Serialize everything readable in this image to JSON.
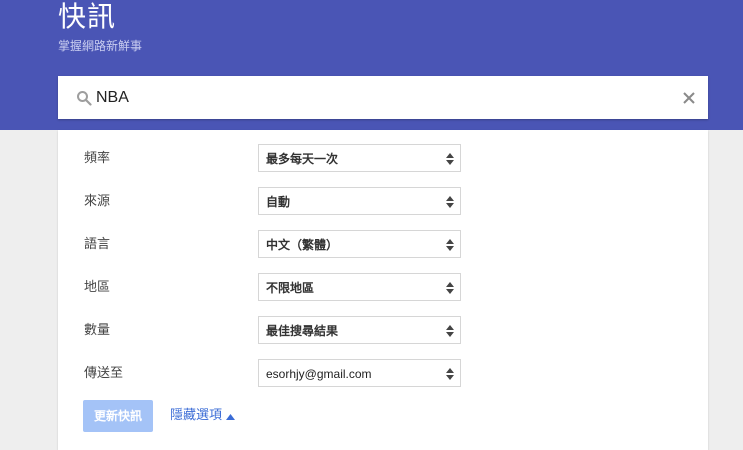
{
  "header": {
    "title": "快訊",
    "subtitle": "掌握網路新鮮事"
  },
  "search": {
    "value": "NBA",
    "icon": "search-icon",
    "clear_icon": "close-icon"
  },
  "options": [
    {
      "label": "頻率",
      "value": "最多每天一次"
    },
    {
      "label": "來源",
      "value": "自動"
    },
    {
      "label": "語言",
      "value": "中文（繁體）"
    },
    {
      "label": "地區",
      "value": "不限地區"
    },
    {
      "label": "數量",
      "value": "最佳搜尋結果"
    },
    {
      "label": "傳送至",
      "value": "esorhjy@gmail.com"
    }
  ],
  "actions": {
    "update_label": "更新快訊",
    "hide_options_label": "隱藏選項"
  },
  "colors": {
    "header_bg": "#4a55b5",
    "button_bg": "#a4c3f7",
    "link": "#3b6cd6"
  }
}
